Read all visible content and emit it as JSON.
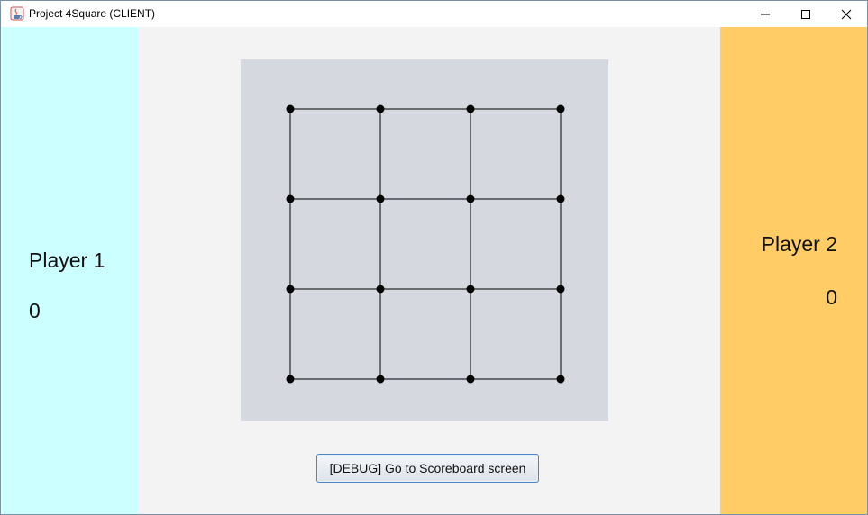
{
  "window": {
    "title": "Project 4Square (CLIENT)",
    "app_icon": "java-coffee-cup-icon",
    "controls": [
      "minimize-icon",
      "maximize-icon",
      "close-icon"
    ]
  },
  "player1": {
    "name": "Player 1",
    "score": "0",
    "panel_color": "#ccffff"
  },
  "player2": {
    "name": "Player 2",
    "score": "0",
    "panel_color": "#ffcc66"
  },
  "board": {
    "rows_of_dots": 4,
    "cols_of_dots": 4,
    "background_color": "#d5d8de",
    "line_color": "#000000",
    "dot_color": "#000000"
  },
  "debug_button": {
    "label": "[DEBUG] Go to Scoreboard screen"
  }
}
